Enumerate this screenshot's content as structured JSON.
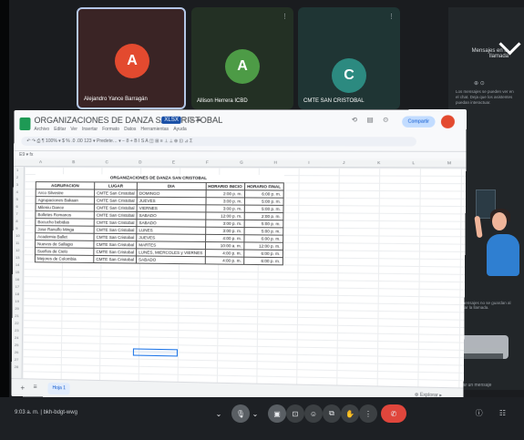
{
  "participants": [
    {
      "initial": "A",
      "name": "Alejandro Yance Barragán"
    },
    {
      "initial": "A",
      "name": "Allison Herrera ICBD"
    },
    {
      "initial": "C",
      "name": "CMTE SAN CRISTOBAL"
    }
  ],
  "side_panel": {
    "title": "Mensajes en la llamada",
    "lock": "⊕ ⊙",
    "desc": "Los mensajes se pueden ver en el chat. Deja que los asistentes puedan interactuar.",
    "hint": "Los mensajes no se guardan al finalizar la llamada.",
    "hint2": "Enviar un mensaje"
  },
  "sheet": {
    "title": "ORGANIZACIONES DE DANZA SAN CRISTOBAL",
    "badge": "XLSX",
    "icons": "☆ ⊡ ☁",
    "menu": [
      "Archivo",
      "Editar",
      "Ver",
      "Insertar",
      "Formato",
      "Datos",
      "Herramientas",
      "Ayuda"
    ],
    "toolbar": "↶ ↷ ⎙ ¶ 100% ▾ $ % .0 .00 123 ▾ Predete… ▾ − 8 + B I S A ◫ ⊞ ≡ ⊥ ⟂ ⊕ ⊡ ⊿ Σ",
    "header_icons": "⟲ ▤ ⊙",
    "share_label": "Compartir",
    "formula_bar": "E9  ▾  fx",
    "col_letters": [
      "A",
      "B",
      "C",
      "D",
      "E",
      "F",
      "G",
      "H",
      "I",
      "J",
      "K",
      "L",
      "M"
    ],
    "row_numbers": [
      "1",
      "2",
      "3",
      "4",
      "5",
      "6",
      "7",
      "8",
      "9",
      "10",
      "11",
      "12",
      "13",
      "14",
      "15",
      "16",
      "17",
      "18",
      "19",
      "20",
      "21",
      "22",
      "23",
      "24",
      "25",
      "26",
      "27",
      "28"
    ],
    "table": {
      "caption": "ORGANIZACIONES DE DANZA SAN CRISTOBAL",
      "headers": [
        "AGRUPACION",
        "LUGAR",
        "DIA",
        "HORARIO INICIO",
        "HORARIO FINAL"
      ],
      "rows": [
        [
          "Arco Silvestre",
          "CMTE San Cristobal",
          "DOMINGO",
          "2:00 p. m.",
          "6:00 p. m."
        ],
        [
          "Agrupaciones Bakaan",
          "CMTE San Cristobal",
          "JUEVES",
          "3:00 p. m.",
          "5:00 p. m."
        ],
        [
          "Mileniu Dance",
          "CMTE San Cristobal",
          "VIERNES",
          "3:00 p. m.",
          "5:00 p. m."
        ],
        [
          "Bolletes Romanos",
          "CMTE San Cristobal",
          "SABADO",
          "12:00 p. m.",
          "2:00 p. m."
        ],
        [
          "Bocucho bebidas",
          "CMTE San Cristobal",
          "SABADO",
          "3:00 p. m.",
          "5:00 p. m."
        ],
        [
          "Jose Ranulfo Minga",
          "CMTE San Cristobal",
          "LUNES",
          "3:00 p. m.",
          "5:00 p. m."
        ],
        [
          "Academia Ballet",
          "CMTE San Cristobal",
          "JUEVES",
          "4:00 p. m.",
          "6:00 p. m."
        ],
        [
          "Nuevos de Sallagio",
          "CMTE San Cristobal",
          "MARTES",
          "10:00 a. m.",
          "12:00 p. m."
        ],
        [
          "Sueños de Cielo",
          "CMTE San Cristobal",
          "LUNES, MIERCOLES y VIERNES",
          "4:00 p. m.",
          "6:00 p. m."
        ],
        [
          "Mejores de Colombia",
          "CMTE San Cristobal",
          "SABADO",
          "4:00 p. m.",
          "6:00 p. m."
        ]
      ]
    },
    "tab_label": "Hoja 1",
    "explore_label": "⊕ Explorar ▸"
  },
  "meeting_bar": {
    "time": "9:03 a. m.  |  bkh-bdgt-wwg",
    "controls": [
      "⌄",
      "🎙",
      "⌄",
      "▣",
      "⊡",
      "☺",
      "⧉",
      "✋",
      "⋮",
      "✆"
    ],
    "end_icons": "ⓘ ☷"
  },
  "colors": {
    "tile1": "#3a2425",
    "tile2": "#233024",
    "tile3": "#1f3534",
    "avatar_red": "#e34a2f",
    "avatar_green": "#4d9b46",
    "avatar_teal": "#2c8a80",
    "end_call": "#e0463c",
    "sheets_green": "#1e9a55"
  }
}
